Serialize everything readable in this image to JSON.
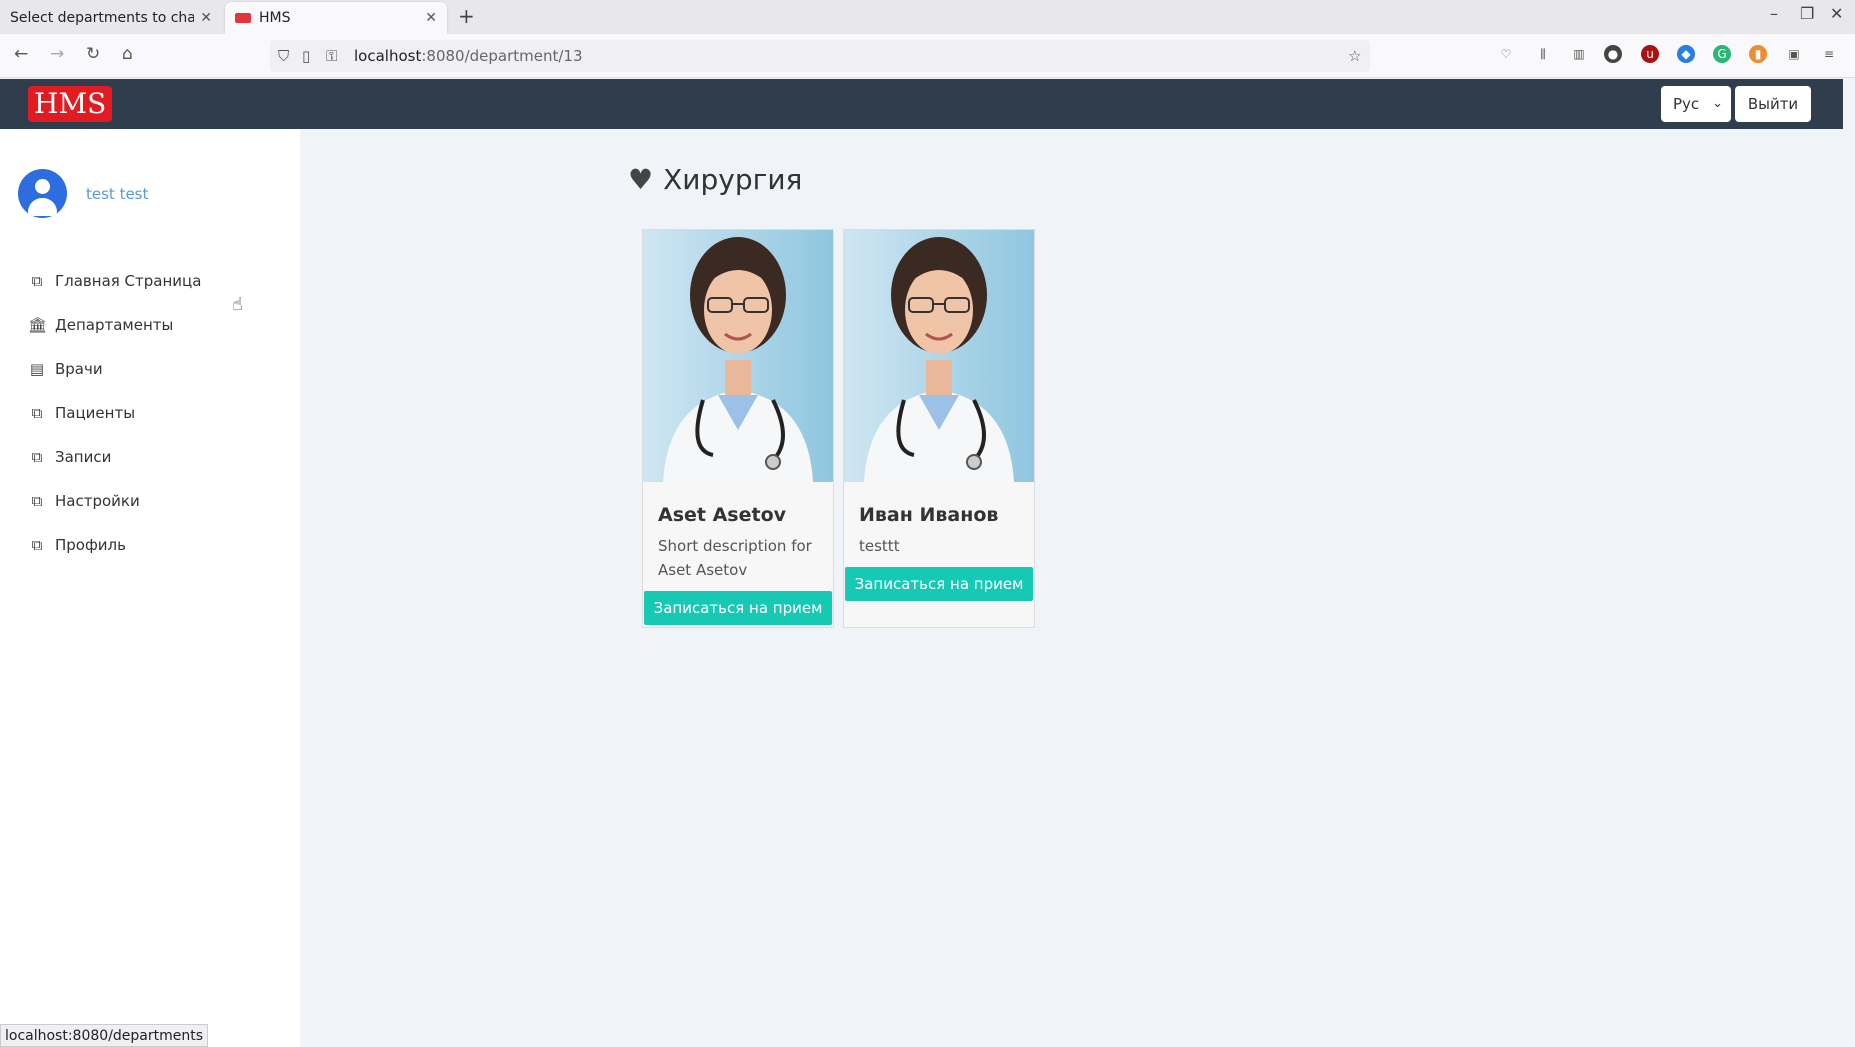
{
  "browser": {
    "tabs": [
      {
        "label": "Select departments to chang",
        "active": false
      },
      {
        "label": "HMS",
        "active": true
      }
    ],
    "url_host": "localhost",
    "url_path": ":8080/department/13",
    "status_url": "localhost:8080/departments"
  },
  "header": {
    "logo": "HMS",
    "language": "Рус",
    "logout": "Выйти",
    "bg_color": "#2f3d4c",
    "logo_color": "#e01b22"
  },
  "sidebar": {
    "username": "test test",
    "items": [
      {
        "label": "Главная Страница",
        "icon": "external-link-icon"
      },
      {
        "label": "Департаменты",
        "icon": "bank-icon"
      },
      {
        "label": "Врачи",
        "icon": "id-card-icon"
      },
      {
        "label": "Пациенты",
        "icon": "external-link-icon"
      },
      {
        "label": "Записи",
        "icon": "external-link-icon"
      },
      {
        "label": "Настройки",
        "icon": "external-link-icon"
      },
      {
        "label": "Профиль",
        "icon": "external-link-icon"
      }
    ]
  },
  "department": {
    "title": "Хирургия",
    "icon": "heartbeat-icon"
  },
  "doctors": [
    {
      "name": "Aset Asetov",
      "description": "Short description for Aset Asetov",
      "button": "Записаться на прием"
    },
    {
      "name": "Иван Иванов",
      "description": "testtt",
      "button": "Записаться на прием"
    }
  ],
  "accent_color": "#17c9b4"
}
